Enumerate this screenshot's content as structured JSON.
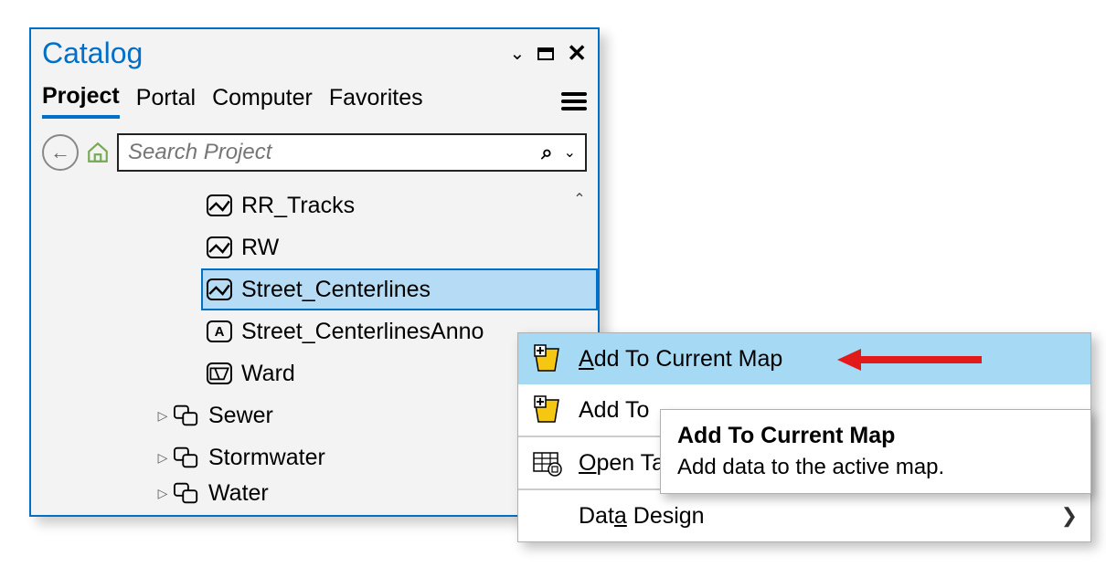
{
  "panel": {
    "title": "Catalog",
    "tabs": [
      "Project",
      "Portal",
      "Computer",
      "Favorites"
    ],
    "active_tab": 0,
    "search_placeholder": "Search Project"
  },
  "tree": {
    "leaf_items": [
      {
        "label": "RR_Tracks",
        "icon": "fc-line"
      },
      {
        "label": "RW",
        "icon": "fc-line"
      },
      {
        "label": "Street_Centerlines",
        "icon": "fc-line",
        "selected": true
      },
      {
        "label": "Street_CenterlinesAnno",
        "icon": "anno"
      },
      {
        "label": "Ward",
        "icon": "fc-poly"
      }
    ],
    "datasets": [
      {
        "label": "Sewer"
      },
      {
        "label": "Stormwater"
      },
      {
        "label": "Water"
      }
    ]
  },
  "context_menu": {
    "items": [
      {
        "label_pre": "",
        "label_u": "A",
        "label_post": "dd To Current Map",
        "icon": "add-map",
        "highlight": true
      },
      {
        "label_pre": "Add To ",
        "label_u": "",
        "label_post": "",
        "icon": "add-map",
        "truncated": true
      },
      {
        "label_pre": "",
        "label_u": "O",
        "label_post": "pen Ta",
        "icon": "table",
        "sep_before": true,
        "truncated": true
      },
      {
        "label_pre": "Dat",
        "label_u": "a",
        "label_post": " Design",
        "icon": "",
        "sep_before": true,
        "submenu": true
      }
    ]
  },
  "tooltip": {
    "title": "Add To Current Map",
    "desc": "Add data to the active map."
  }
}
